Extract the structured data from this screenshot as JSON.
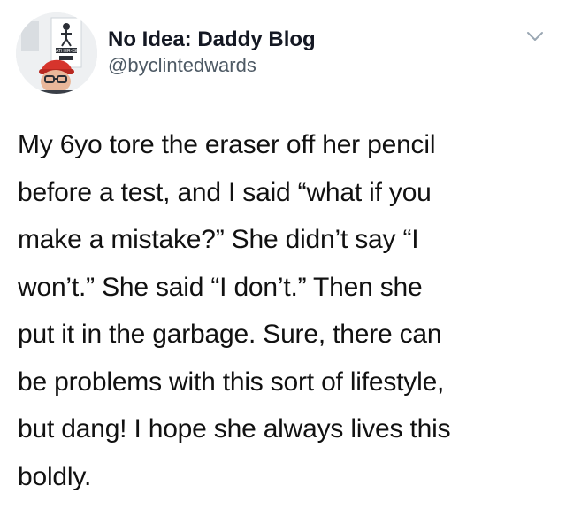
{
  "author": {
    "display_name": "No Idea: Daddy Blog",
    "handle": "@byclintedwards",
    "avatar": {
      "icon": "profile-photo",
      "sign_text": "FATHER-ISH"
    }
  },
  "menu": {
    "icon": "chevron-down-icon"
  },
  "tweet": {
    "lines": [
      "My 6yo tore the eraser off her pencil",
      "before a test, and I said “what if you",
      "make a mistake?” She didn’t say “I",
      "won’t.” She said “I don’t.” Then she",
      "put it in the garbage. Sure, there can",
      "be problems with this sort of lifestyle,",
      "but dang! I hope she always lives this",
      "boldly."
    ]
  },
  "colors": {
    "name": "#141823",
    "handle": "#4e5a65",
    "text": "#111111",
    "chevron": "#9aa7b3",
    "background": "#ffffff"
  }
}
